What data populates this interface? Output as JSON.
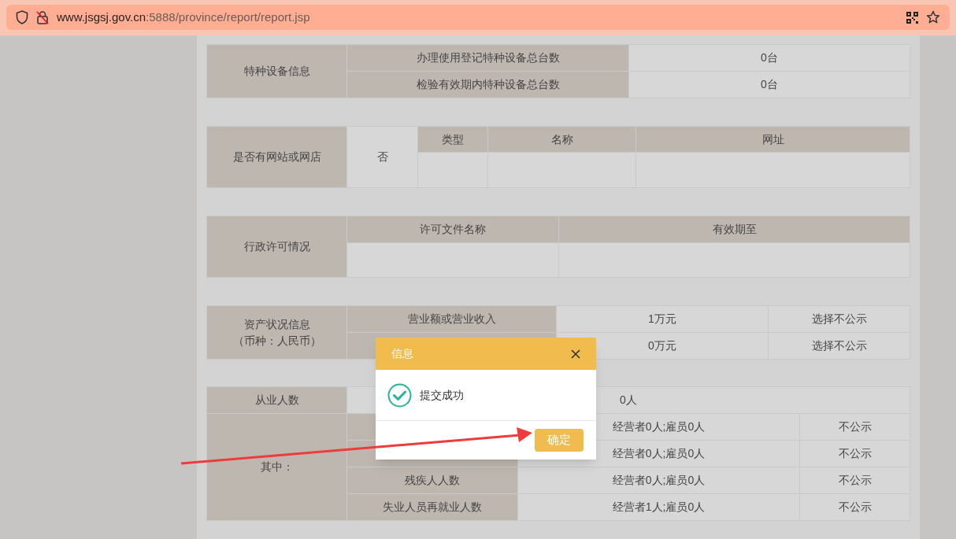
{
  "browser": {
    "url_host": "www.jsgsj.gov.cn",
    "url_path": ":5888/province/report/report.jsp"
  },
  "special_equipment": {
    "label": "特种设备信息",
    "rows": [
      {
        "label": "办理使用登记特种设备总台数",
        "value": "0台"
      },
      {
        "label": "检验有效期内特种设备总台数",
        "value": "0台"
      }
    ]
  },
  "website": {
    "label": "是否有网站或网店",
    "answer": "否",
    "columns": [
      "类型",
      "名称",
      "网址"
    ]
  },
  "permits": {
    "label": "行政许可情况",
    "columns": [
      "许可文件名称",
      "有效期至"
    ]
  },
  "assets": {
    "label_lines": [
      "资产状况信息",
      "（币种：人民币）"
    ],
    "rows": [
      {
        "label": "营业额或营业收入",
        "value": "1万元",
        "publicity": "选择不公示"
      },
      {
        "value": "0万元",
        "publicity": "选择不公示"
      }
    ]
  },
  "employees": {
    "label": "从业人数",
    "value": "0人",
    "breakdown_label": "其中：",
    "rows": [
      {
        "value": "经营者0人;雇员0人",
        "publicity": "不公示"
      },
      {
        "value": "经营者0人;雇员0人",
        "publicity": "不公示"
      },
      {
        "label": "残疾人人数",
        "value": "经营者0人;雇员0人",
        "publicity": "不公示"
      },
      {
        "label": "失业人员再就业人数",
        "value": "经营者1人;雇员0人",
        "publicity": "不公示"
      }
    ]
  },
  "dialog": {
    "title": "信息",
    "message": "提交成功",
    "button": "确定"
  }
}
